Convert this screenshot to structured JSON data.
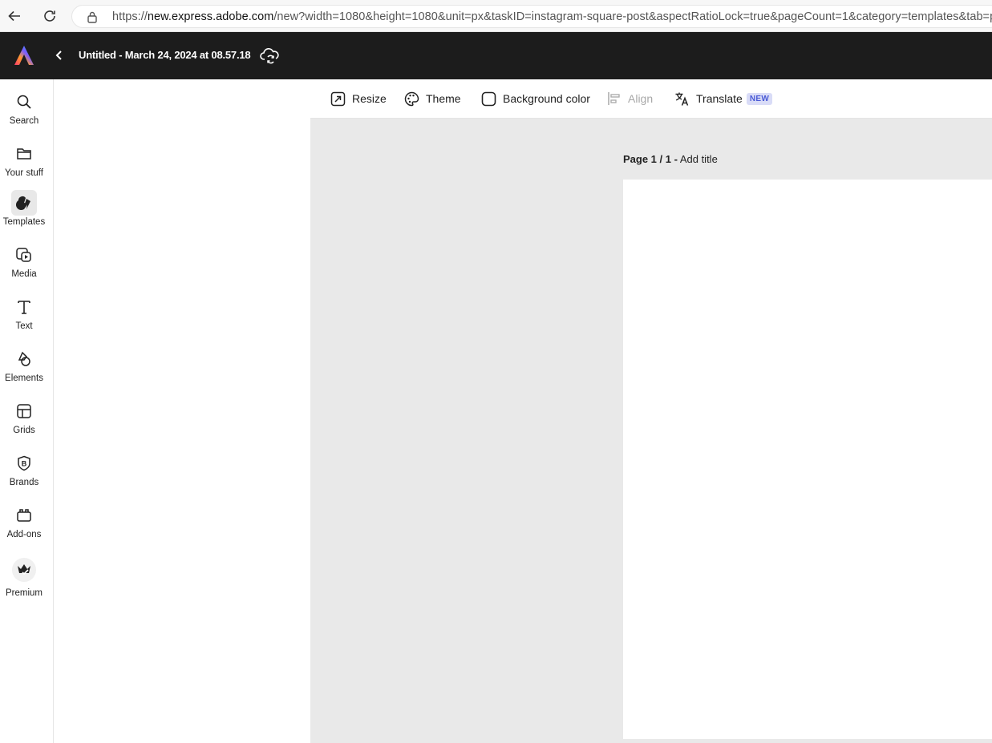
{
  "browser": {
    "url_prefix": "https://",
    "url_host": "new.express.adobe.com",
    "url_rest": "/new?width=1080&height=1080&unit=px&taskID=instagram-square-post&aspectRatioLock=true&pageCount=1&category=templates&tab=phot"
  },
  "header": {
    "doc_title": "Untitled - March 24, 2024 at 08.57.18"
  },
  "rail": {
    "items": [
      {
        "label": "Search",
        "icon": "search-icon"
      },
      {
        "label": "Your stuff",
        "icon": "folder-icon"
      },
      {
        "label": "Templates",
        "icon": "templates-icon",
        "active": true
      },
      {
        "label": "Media",
        "icon": "media-icon"
      },
      {
        "label": "Text",
        "icon": "text-icon"
      },
      {
        "label": "Elements",
        "icon": "elements-icon"
      },
      {
        "label": "Grids",
        "icon": "grid-icon"
      },
      {
        "label": "Brands",
        "icon": "brand-icon"
      },
      {
        "label": "Add-ons",
        "icon": "addons-icon"
      },
      {
        "label": "Premium",
        "icon": "crown-icon"
      }
    ]
  },
  "toolbar": {
    "resize": "Resize",
    "theme": "Theme",
    "background_color": "Background color",
    "align": "Align",
    "translate": "Translate",
    "new_badge": "NEW"
  },
  "canvas": {
    "page_indicator": "Page 1 / 1 -",
    "add_title": "Add title"
  },
  "colors": {
    "header_bg": "#1c1c1c",
    "workspace_bg": "#e9e9e9",
    "badge_bg": "#d9dcf7",
    "badge_text": "#4b5bd6"
  }
}
